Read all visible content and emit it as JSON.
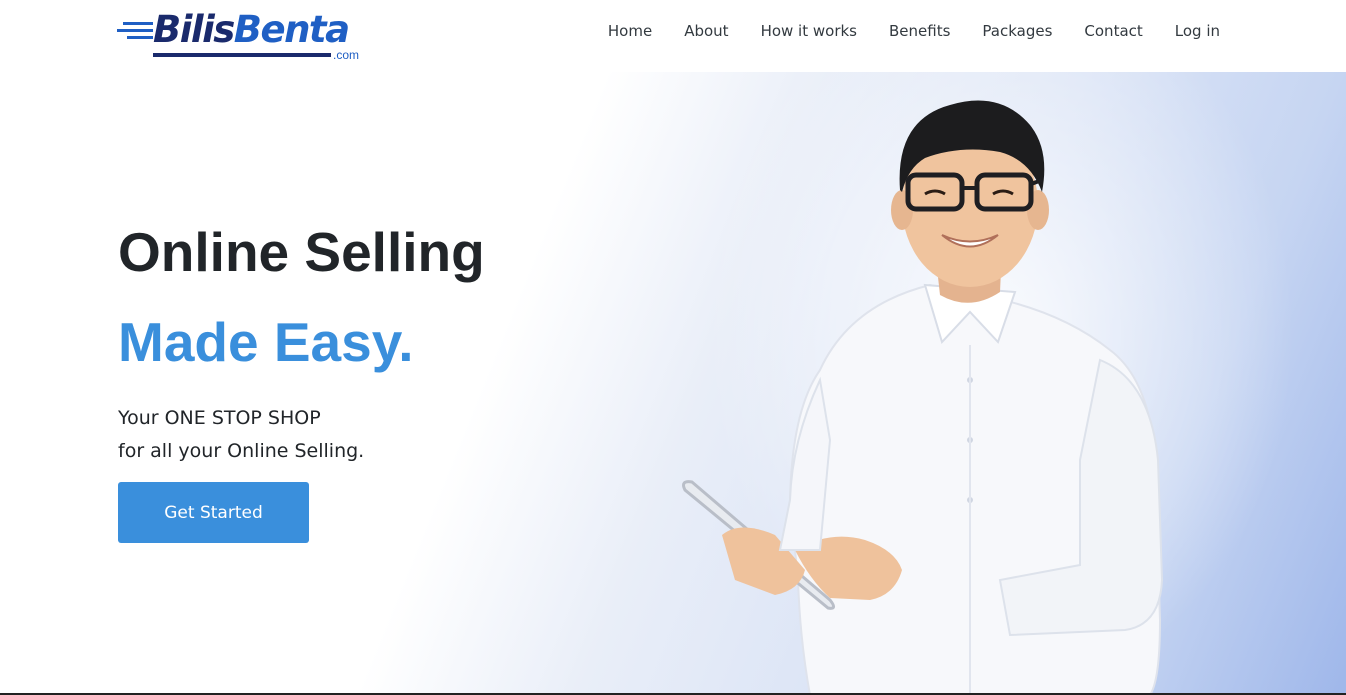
{
  "brand": {
    "name_part1": "Bilis",
    "name_part2": "Benta",
    "suffix": ".com",
    "colors": {
      "dark": "#1a2a6c",
      "blue": "#1f5fc4"
    }
  },
  "nav": {
    "items": [
      {
        "label": "Home"
      },
      {
        "label": "About"
      },
      {
        "label": "How it works"
      },
      {
        "label": "Benefits"
      },
      {
        "label": "Packages"
      },
      {
        "label": "Contact"
      },
      {
        "label": "Log in"
      }
    ]
  },
  "hero": {
    "headline_line1": "Online Selling",
    "headline_line2": "Made Easy.",
    "tagline_line1": "Your ONE STOP SHOP",
    "tagline_line2": "for all your Online Selling.",
    "cta_label": "Get Started",
    "accent_color": "#3a8fdc",
    "image": "smiling man in white shirt with glasses holding a tablet"
  }
}
